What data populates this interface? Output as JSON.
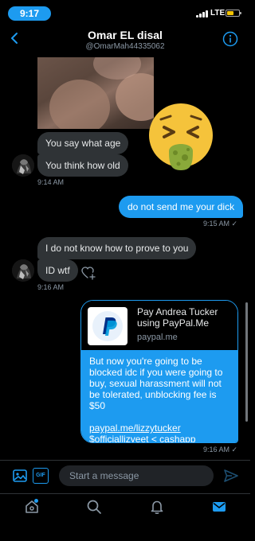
{
  "status_bar": {
    "time": "9:17",
    "network": "LTE",
    "battery_level": 0.6
  },
  "header": {
    "name": "Omar EL disal",
    "handle": "@OmarMah44335062"
  },
  "messages": [
    {
      "type": "image",
      "direction": "incoming"
    },
    {
      "type": "text",
      "direction": "incoming",
      "text": "You say what age"
    },
    {
      "type": "text",
      "direction": "incoming",
      "text": "You think how old"
    },
    {
      "type": "timestamp",
      "text": "9:14 AM"
    },
    {
      "type": "text",
      "direction": "outgoing",
      "text": "do not send me your dick"
    },
    {
      "type": "timestamp",
      "text": "9:15 AM ✓"
    },
    {
      "type": "text",
      "direction": "incoming",
      "text": "I do not know how to prove to you"
    },
    {
      "type": "text",
      "direction": "incoming",
      "text": "ID wtf"
    },
    {
      "type": "timestamp",
      "text": "9:16 AM"
    },
    {
      "type": "timestamp",
      "text": "9:16 AM ✓"
    }
  ],
  "sticker": {
    "icon": "nauseated-face-emoji"
  },
  "link_card": {
    "title": "Pay Andrea Tucker using PayPal.Me",
    "domain": "paypal.me",
    "icon": "paypal-logo-icon",
    "message": "But now you're going to be blocked idc if you were going to buy, sexual harassment will not be tolerated, unblocking fee is $50",
    "link": "paypal.me/lizzytucker",
    "cashtag": "$officiallizyeet < cashapp"
  },
  "compose": {
    "placeholder": "Start a message",
    "gif_label": "GIF"
  },
  "tabs": [
    "home-icon",
    "search-icon",
    "notifications-icon",
    "messages-icon"
  ],
  "colors": {
    "accent": "#1d9bf0",
    "incoming_bubble": "#2f3336",
    "background": "#000000",
    "muted_text": "#8b98a5"
  }
}
